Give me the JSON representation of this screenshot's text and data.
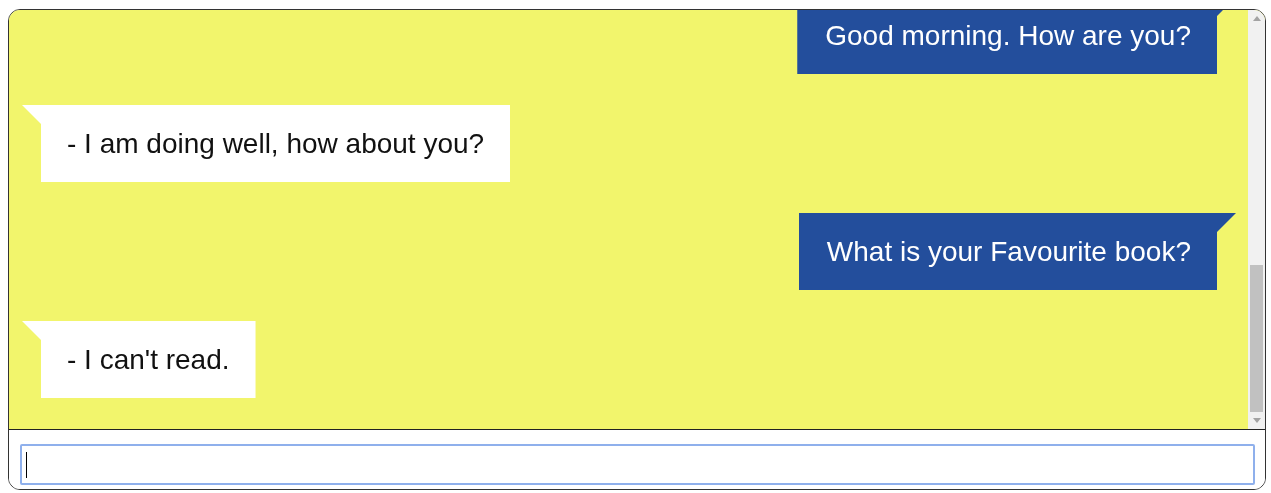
{
  "messages": [
    {
      "kind": "sent",
      "text": "Good morning. How are you?"
    },
    {
      "kind": "received",
      "text": "- I am doing well, how about you?"
    },
    {
      "kind": "sent",
      "text": "What is your Favourite book?"
    },
    {
      "kind": "received",
      "text": "- I can't read."
    }
  ],
  "input": {
    "focused": true
  }
}
